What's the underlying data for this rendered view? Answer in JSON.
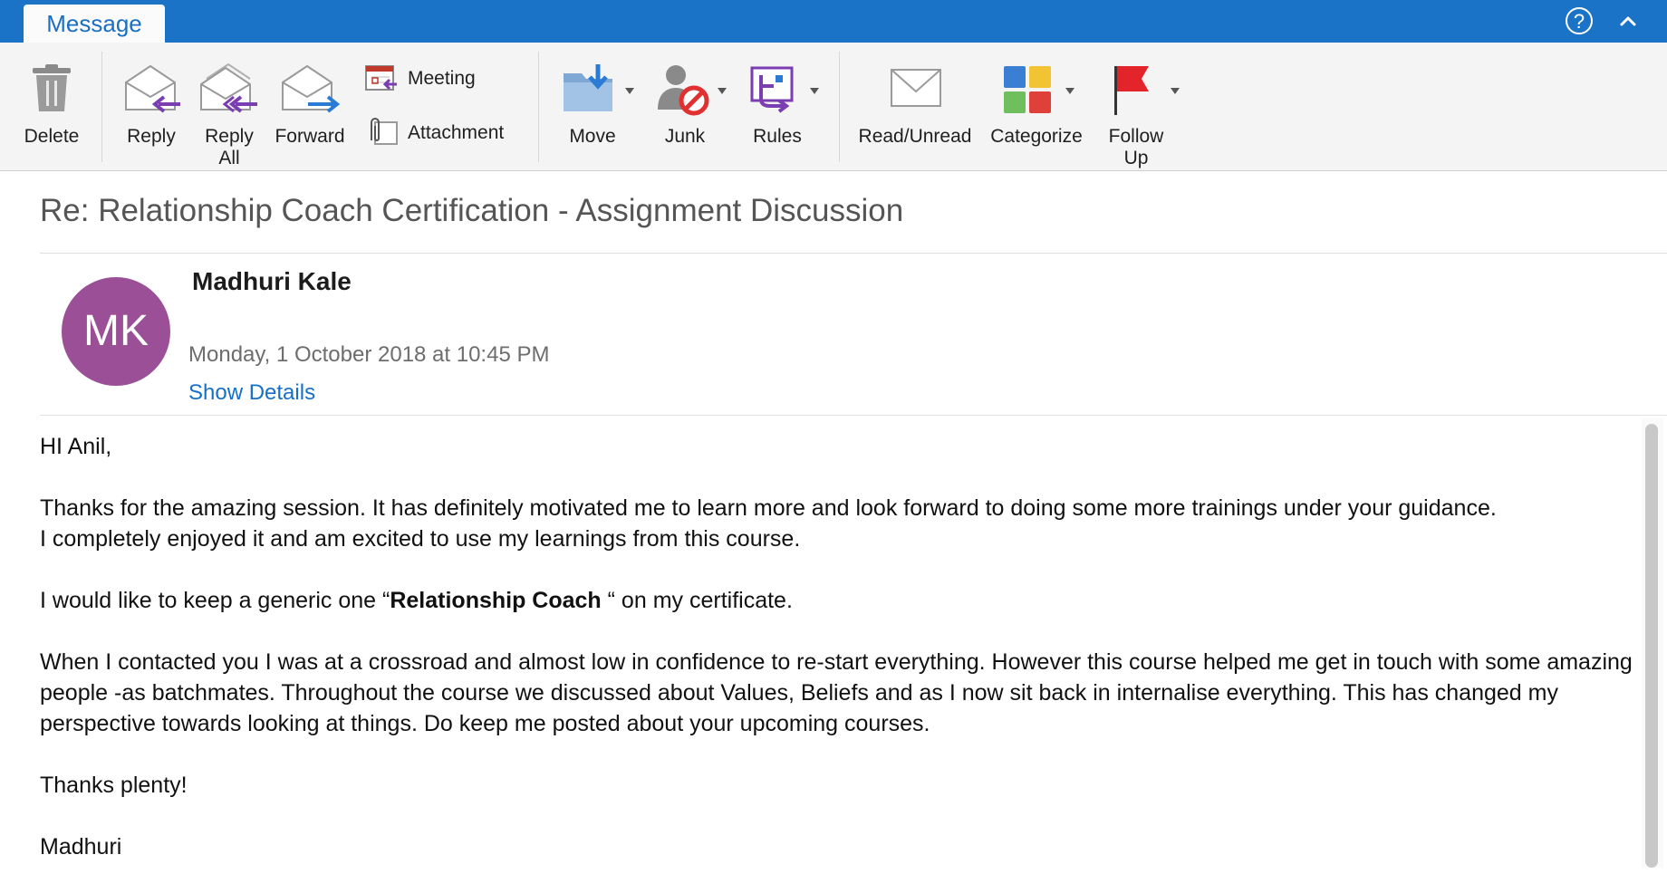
{
  "tabs": {
    "active": "Message"
  },
  "toolbar": {
    "delete": "Delete",
    "reply": "Reply",
    "reply_all_line1": "Reply",
    "reply_all_line2": "All",
    "forward": "Forward",
    "meeting": "Meeting",
    "attachment": "Attachment",
    "move": "Move",
    "junk": "Junk",
    "rules": "Rules",
    "read_unread": "Read/Unread",
    "categorize": "Categorize",
    "follow_up_line1": "Follow",
    "follow_up_line2": "Up"
  },
  "colors": {
    "topbar": "#1a73c6",
    "avatar": "#9b4f96",
    "link": "#1670c6",
    "flag": "#e3242b"
  },
  "message": {
    "subject": "Re: Relationship Coach Certification - Assignment Discussion",
    "avatar_initials": "MK",
    "sender": "Madhuri Kale",
    "datetime": "Monday, 1 October 2018 at 10:45 PM",
    "show_details": "Show Details",
    "body": {
      "greeting": "HI Anil,",
      "para1_line1": "Thanks for the amazing session. It has definitely motivated me to learn more and look forward to doing some more trainings under your guidance.",
      "para1_line2": "I completely enjoyed it and am excited to use my learnings from this course.",
      "para2_before": "I would like to keep a generic one “",
      "para2_bold": "Relationship Coach",
      "para2_after": " “ on my certificate.",
      "para3": "When I contacted you I was at a crossroad and almost low in confidence to re-start everything. However this course helped me get in touch with some amazing people -as batchmates. Throughout the course we discussed about Values, Beliefs and as I now sit back in internalise everything. This has changed my perspective towards looking at things. Do keep me posted about your upcoming courses.",
      "closing": "Thanks plenty!",
      "signature": "Madhuri"
    }
  }
}
